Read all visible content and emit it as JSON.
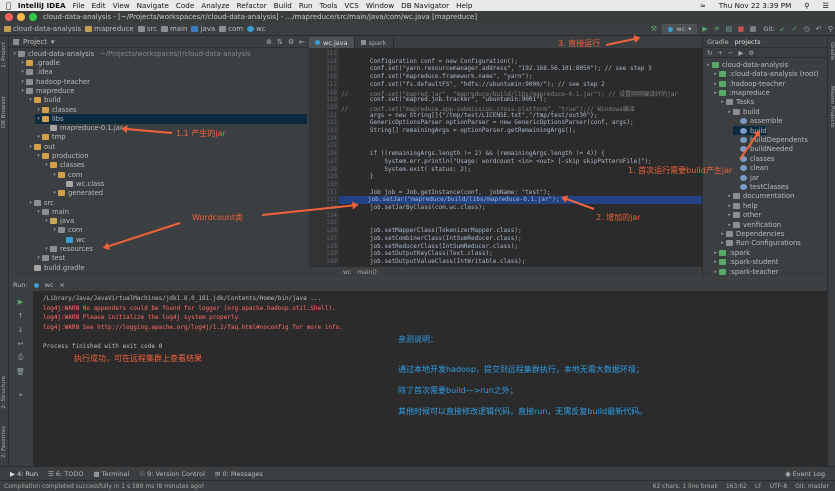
{
  "macbar": {
    "app": "IntelliJ IDEA",
    "menus": [
      "File",
      "Edit",
      "View",
      "Navigate",
      "Code",
      "Analyze",
      "Refactor",
      "Build",
      "Run",
      "Tools",
      "VCS",
      "Window",
      "DB Navigator",
      "Help"
    ],
    "clock": "Thu Nov 22  3:39 PM"
  },
  "window": {
    "title": "cloud-data-analysis - [~/Projects/workspaces/r/cloud-data-analysis] - .../mapreduce/src/main/java/com/wc.java [mapreduce]"
  },
  "toolbar": {
    "breadcrumbs": [
      "cloud-data-analysis",
      "mapreduce",
      "src",
      "main",
      "java",
      "com",
      "wc"
    ],
    "run_config": "wc",
    "git_label": "Git:"
  },
  "project": {
    "header": "Project",
    "path_hint": "~/Projects/workspaces/r/cloud-data-analysis",
    "tree": [
      {
        "label": "cloud-data-analysis",
        "depth": 0,
        "icon": "folder"
      },
      {
        "label": ".gradle",
        "depth": 1,
        "icon": "folder-o"
      },
      {
        "label": ".idea",
        "depth": 1,
        "icon": "folder"
      },
      {
        "label": "hadoop-teacher",
        "depth": 1,
        "icon": "folder"
      },
      {
        "label": "mapreduce",
        "depth": 1,
        "icon": "folder"
      },
      {
        "label": "build",
        "depth": 2,
        "icon": "folder-o"
      },
      {
        "label": "classes",
        "depth": 3,
        "icon": "folder-o"
      },
      {
        "label": "libs",
        "depth": 3,
        "icon": "folder-o"
      },
      {
        "label": "mapreduce-0.1.jar",
        "depth": 4,
        "icon": "filej"
      },
      {
        "label": "tmp",
        "depth": 3,
        "icon": "folder-o"
      },
      {
        "label": "out",
        "depth": 2,
        "icon": "folder-o"
      },
      {
        "label": "production",
        "depth": 3,
        "icon": "folder-o"
      },
      {
        "label": "classes",
        "depth": 4,
        "icon": "folder-o"
      },
      {
        "label": "com",
        "depth": 5,
        "icon": "folder-o"
      },
      {
        "label": "wc.class",
        "depth": 6,
        "icon": "filej"
      },
      {
        "label": "generated",
        "depth": 5,
        "icon": "folder-o"
      },
      {
        "label": "src",
        "depth": 2,
        "icon": "folder"
      },
      {
        "label": "main",
        "depth": 3,
        "icon": "folder"
      },
      {
        "label": "java",
        "depth": 4,
        "icon": "folder-y"
      },
      {
        "label": "com",
        "depth": 5,
        "icon": "folder"
      },
      {
        "label": "wc",
        "depth": 6,
        "icon": "filec"
      },
      {
        "label": "resources",
        "depth": 4,
        "icon": "folder"
      },
      {
        "label": "test",
        "depth": 3,
        "icon": "folder"
      },
      {
        "label": "build.gradle",
        "depth": 2,
        "icon": "filej"
      }
    ]
  },
  "editor": {
    "tabs": [
      "wc.java",
      "spark"
    ],
    "first_line": 113,
    "lines": [
      "",
      "        Configuration conf = new Configuration();",
      "        conf.set(\"yarn.resourcemanager.address\", \"192.168.56.101:8050\"); // see step 3",
      "        conf.set(\"mapreduce.framework.name\", \"yarn\");",
      "        conf.set(\"fs.defaultFS\", \"hdfs://ubuntumin:9000/\"); // see step 2",
      "//      conf.set(\"mapred.jar\", \"mapreduce/build/libs/mapreduce-0.1.jar\"); // 设置刚刚编译好的jar",
      "        conf.set(\"mapred.job.tracker\", \"ubuntumin:9001\");",
      "//      conf.set(\"mapreduce.app-submission.cross-platform\", \"true\");// Windows编译",
      "        args = new String[]{\"/tmp/test/LICENSE.txt\",\"/tmp/test/out30\"};",
      "        GenericOptionsParser optionParser = new GenericOptionsParser(conf, args);",
      "        String[] remainingArgs = optionParser.getRemainingArgs();",
      "",
      "",
      "        if ((remainingArgs.length != 2) && (remainingArgs.length != 4)) {",
      "            System.err.println(\"Usage: wordcount <in> <out> [-skip skipPatternFile]\");",
      "            System.exit( status: 2);",
      "        }",
      "",
      "        Job job = Job.getInstance(conf,  jobName: \"test\");",
      "        job.setJar(\"mapreduce/build/libs/mapreduce-0.1.jar\");",
      "        job.setJarByClass(com.wc.class);",
      "",
      "",
      "        job.setMapperClass(TokenizerMapper.class);",
      "        job.setCombinerClass(IntSumReducer.class);",
      "        job.setReducerClass(IntSumReducer.class);",
      "        job.setOutputKeyClass(Text.class);",
      "        job.setOutputValueClass(IntWritable.class);"
    ],
    "highlight_line": 19,
    "crumb": [
      "wc",
      "main()"
    ]
  },
  "gradle": {
    "header": "Gradle",
    "tab": "projects",
    "tree": [
      {
        "label": "cloud-data-analysis",
        "depth": 0
      },
      {
        "label": ":cloud-data-analysis (root)",
        "depth": 1
      },
      {
        "label": ":hadoop-teacher",
        "depth": 1
      },
      {
        "label": ":mapreduce",
        "depth": 1
      },
      {
        "label": "Tasks",
        "depth": 2
      },
      {
        "label": "build",
        "depth": 3
      },
      {
        "label": "assemble",
        "depth": 4
      },
      {
        "label": "build",
        "depth": 4
      },
      {
        "label": "buildDependents",
        "depth": 4
      },
      {
        "label": "buildNeeded",
        "depth": 4
      },
      {
        "label": "classes",
        "depth": 4
      },
      {
        "label": "clean",
        "depth": 4
      },
      {
        "label": "jar",
        "depth": 4
      },
      {
        "label": "testClasses",
        "depth": 4
      },
      {
        "label": "documentation",
        "depth": 3
      },
      {
        "label": "help",
        "depth": 3
      },
      {
        "label": "other",
        "depth": 3
      },
      {
        "label": "verification",
        "depth": 3
      },
      {
        "label": "Dependencies",
        "depth": 2
      },
      {
        "label": "Run Configurations",
        "depth": 2
      },
      {
        "label": ":spark",
        "depth": 1
      },
      {
        "label": ":spark-student",
        "depth": 1
      },
      {
        "label": ":spark-teacher",
        "depth": 1
      }
    ]
  },
  "run": {
    "label": "Run:",
    "tab": "wc",
    "output": [
      {
        "text": "/Library/Java/JavaVirtualMachines/jdk1.8.0_181.jdk/Contents/Home/bin/java ...",
        "color": "#bbbbbb"
      },
      {
        "text": "log4j:WARN No appenders could be found for logger (org.apache.hadoop.util.Shell).",
        "color": "#ff6b68"
      },
      {
        "text": "log4j:WARN Please initialize the log4j system properly.",
        "color": "#ff6b68"
      },
      {
        "text": "log4j:WARN See http://logging.apache.org/log4j/1.2/faq.html#noconfig for more info.",
        "color": "#ff6b68"
      },
      {
        "text": "",
        "color": "#bbbbbb"
      },
      {
        "text": "Process finished with exit code 0",
        "color": "#bbbbbb"
      }
    ]
  },
  "annotations": {
    "run_directly": "3. 直接运行",
    "jar_produced": "1.1 产生的jar",
    "first_build": "1. 首次运行需要build产生jar",
    "added_jar": "2. 增加的jar",
    "wordcount_class": "Wordcount类",
    "success": "执行成功，可在远程集群上查看结果",
    "note_title": "亲测说明：",
    "note_line1": "通过本地开发hadoop，提交到远程集群执行，本地无需大数据环境；",
    "note_line2": "除了首次需要build—>run之外；",
    "note_line3": "其他时候可以直接修改逻辑代码，直接run，无需反复build最新代码。"
  },
  "bottom_tabs": [
    "4: Run",
    "6: TODO",
    "Terminal",
    "9: Version Control",
    "0: Messages"
  ],
  "event_log": "Event Log",
  "status": {
    "message": "Compilation completed successfully in 1 s 189 ms (8 minutes ago)",
    "chars": "62 chars, 1 line break",
    "pos": "163:62",
    "lf": "LF",
    "enc": "UTF-8",
    "git": "Git: master"
  },
  "left_strip": [
    "1: Project",
    "DB Browser",
    "2: Structure",
    "2: Favorites"
  ],
  "right_strip": [
    "Gradle",
    "Maven Projects"
  ],
  "colors": {
    "accent": "#f0623b",
    "note": "#2f9ee5",
    "selection": "#214283"
  }
}
